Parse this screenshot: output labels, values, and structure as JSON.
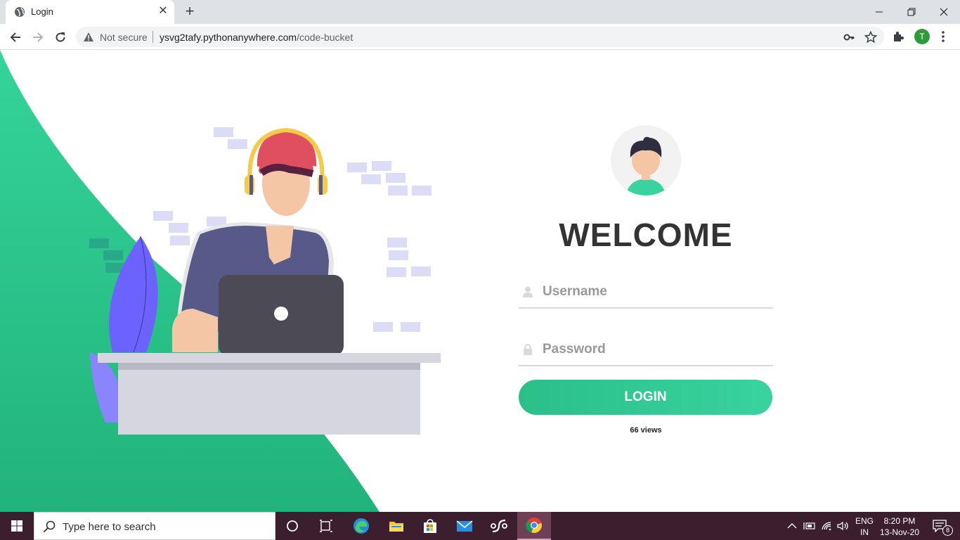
{
  "browser": {
    "tab_title": "Login",
    "url_warning": "Not secure",
    "url_domain": "ysvg2tafy.pythonanywhere.com",
    "url_path": "/code-bucket",
    "profile_initial": "T"
  },
  "login": {
    "heading": "WELCOME",
    "username_placeholder": "Username",
    "password_placeholder": "Password",
    "button_label": "LOGIN",
    "views_text": "66 views"
  },
  "colors": {
    "accent": "#38d39f",
    "accent_dark": "#2bbf8a",
    "taskbar": "#3c1f2f"
  },
  "taskbar": {
    "search_placeholder": "Type here to search",
    "lang_line1": "ENG",
    "lang_line2": "IN",
    "time": "8:20 PM",
    "date": "13-Nov-20",
    "notification_count": "8"
  }
}
